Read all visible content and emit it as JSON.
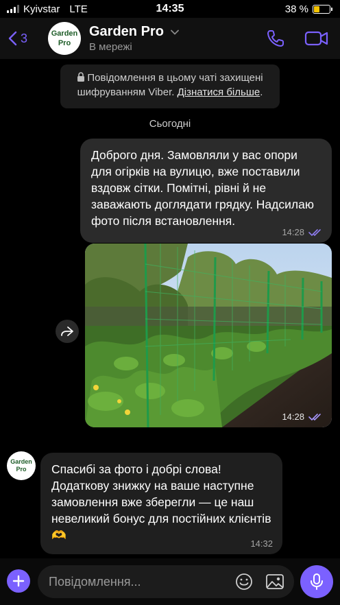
{
  "status_bar": {
    "carrier": "Kyivstar",
    "network": "LTE",
    "time": "14:35",
    "battery_percent": "38 %",
    "battery_level": 0.38
  },
  "header": {
    "back_count": "3",
    "logo_line1": "Garden",
    "logo_line2": "Pro",
    "title": "Garden Pro",
    "subtitle": "В мережі",
    "accent_color": "#7b61ff"
  },
  "chat": {
    "encryption_notice": "Повідомлення в цьому чаті захищені шифруванням Viber.",
    "encryption_link": "Дізнатися більше",
    "encryption_dot": ".",
    "day_separator": "Сьогодні",
    "messages": [
      {
        "direction": "outgoing",
        "text": "Доброго дня. Замовляли у вас опори для огірків на вулицю, вже поставили вздовж сітки. Помітні, рівні й не заважають доглядати грядку. Надсилаю фото після встановлення.",
        "time": "14:28",
        "status_icon": "double-check-icon"
      },
      {
        "direction": "outgoing",
        "type": "photo",
        "time": "14:28",
        "status_icon": "double-check-icon"
      },
      {
        "direction": "incoming",
        "text": "Спасибі за фото і добрі слова! Додаткову знижку на ваше наступне замовлення вже зберегли — це наш невеликий бонус для постійних клієнтів 🫶",
        "time": "14:32"
      }
    ]
  },
  "composer": {
    "placeholder": "Повідомлення..."
  }
}
